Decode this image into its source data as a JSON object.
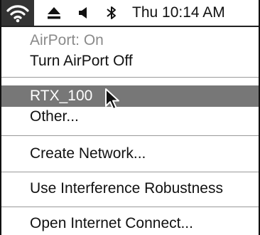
{
  "menubar": {
    "active_icon": "wifi-icon",
    "icons": [
      "wifi-icon",
      "eject-icon",
      "volume-icon",
      "bluetooth-icon"
    ],
    "clock": "Thu 10:14 AM"
  },
  "menu": {
    "status": "AirPort: On",
    "toggle": "Turn AirPort Off",
    "networks": [
      "RTX_100",
      "Other..."
    ],
    "selected_network": "RTX_100",
    "create_network": "Create Network...",
    "interference": "Use Interference Robustness",
    "open_connect": "Open Internet Connect..."
  },
  "colors": {
    "highlight": "#777777",
    "active_menubar_item": "#333333",
    "disabled_text": "#8a8a8a"
  }
}
